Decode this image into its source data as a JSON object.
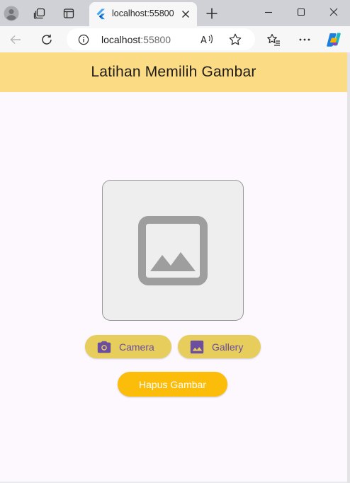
{
  "browser": {
    "tab": {
      "title": "localhost:55800"
    },
    "address": {
      "host": "localhost",
      "port": ":55800"
    },
    "icons": {
      "profile": "profile-icon",
      "workspaces": "workspaces-icon",
      "tab_actions": "tab-actions-icon",
      "favicon": "flutter-icon",
      "close_tab": "close-icon",
      "new_tab": "plus-icon",
      "minimize": "minimize-icon",
      "maximize": "maximize-icon",
      "close_window": "close-window-icon",
      "back": "back-arrow-icon",
      "refresh": "refresh-icon",
      "site_info": "info-icon",
      "read_aloud": "read-aloud-icon",
      "favorite": "star-icon",
      "favorites_list": "favorites-icon",
      "more": "more-icon",
      "copilot": "copilot-icon"
    }
  },
  "app": {
    "title": "Latihan Memilih Gambar",
    "placeholder_icon": "image-placeholder-icon",
    "buttons": {
      "camera": {
        "label": "Camera",
        "icon": "camera-icon"
      },
      "gallery": {
        "label": "Gallery",
        "icon": "photo-icon"
      },
      "clear": {
        "label": "Hapus Gambar"
      }
    },
    "colors": {
      "appbar": "#fbdb84",
      "background": "#fdf7fe",
      "pill_button": "#e6cd5c",
      "pill_text": "#6b4ea0",
      "clear_button": "#fbbd09"
    }
  }
}
